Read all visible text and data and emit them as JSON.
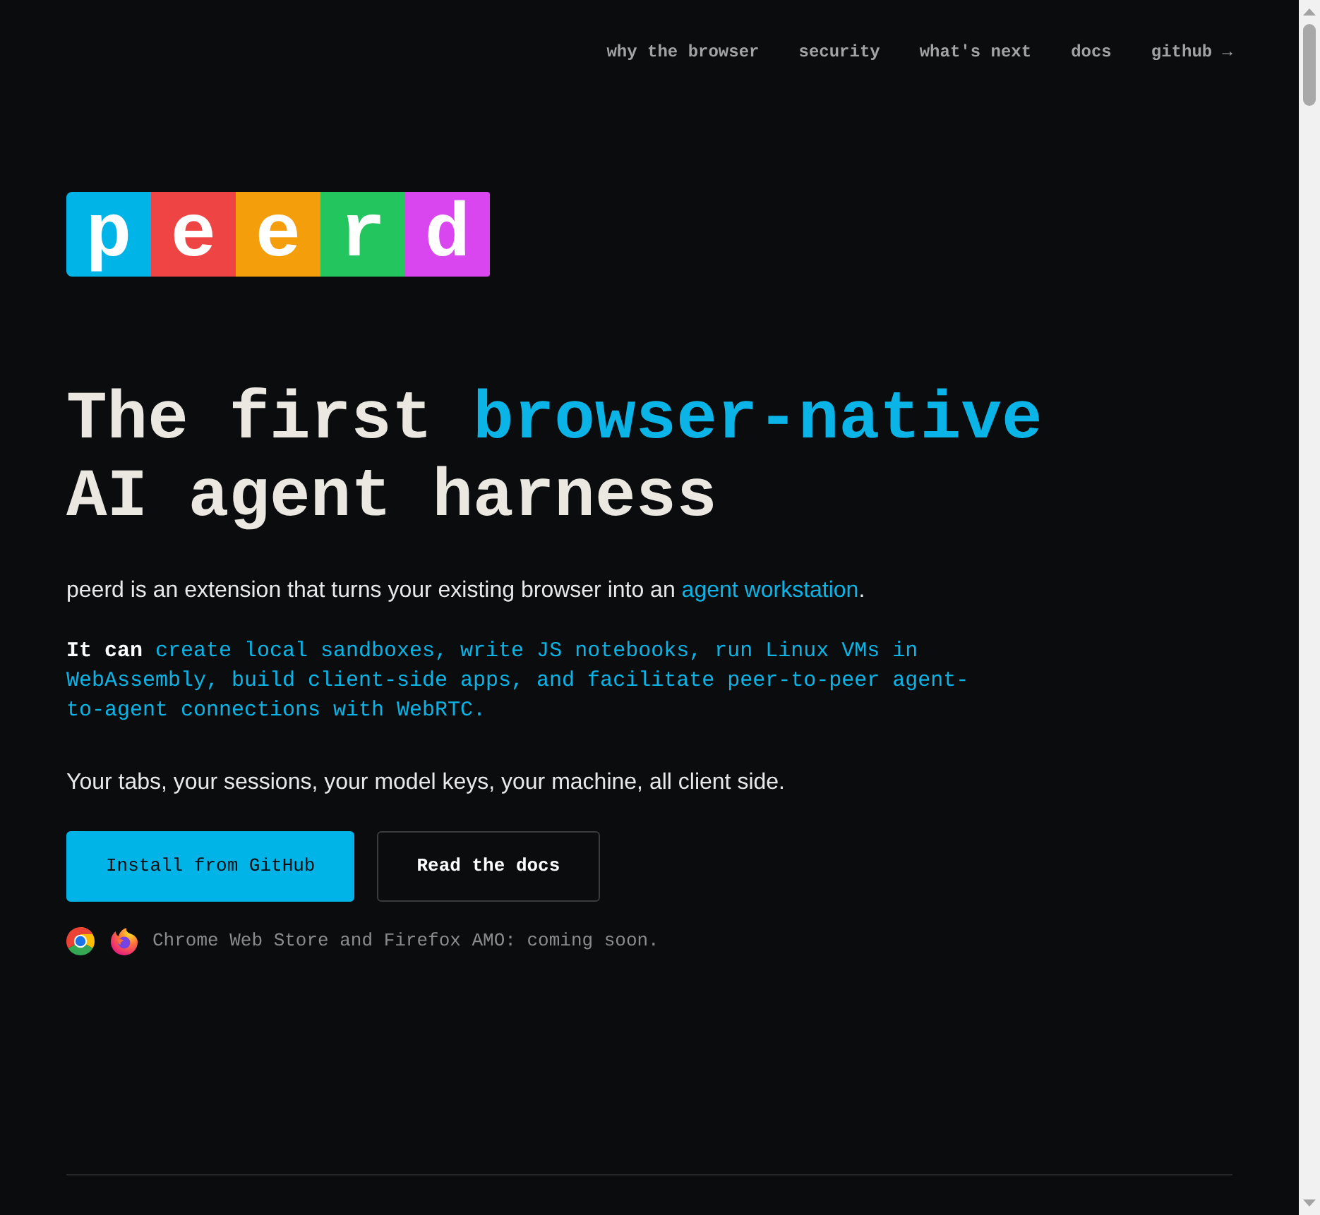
{
  "nav": {
    "links": [
      {
        "label": "why the browser"
      },
      {
        "label": "security"
      },
      {
        "label": "what's next"
      },
      {
        "label": "docs"
      },
      {
        "label": "github →"
      }
    ]
  },
  "logo": {
    "letters": [
      {
        "letter": "p",
        "color": "#00b4e8"
      },
      {
        "letter": "e",
        "color": "#ef4444"
      },
      {
        "letter": "e",
        "color": "#f59e0b"
      },
      {
        "letter": "r",
        "color": "#22c55e"
      },
      {
        "letter": "d",
        "color": "#d946ef"
      }
    ]
  },
  "hero": {
    "heading": [
      {
        "text": "The first ",
        "highlight": false
      },
      {
        "text": "browser-native",
        "highlight": true
      },
      {
        "text": " AI agent harness",
        "highlight": false
      }
    ],
    "intro": {
      "text": "peerd is an extension that turns your existing browser into an ",
      "link": "agent workstation",
      "end": "."
    },
    "capabilities": "**It can** create local sandboxes, write JS notebooks, run Linux VMs in WebAssembly, build client-side apps, and facilitate peer-to-peer agent-to-agent connections with WebRTC.",
    "tagline": "Your tabs, your sessions, your model keys, your machine, all client side.",
    "buttons": [
      {
        "label": "Install from GitHub",
        "kind": "primary"
      },
      {
        "label": "Read the docs",
        "kind": "secondary"
      }
    ],
    "availability": "Chrome Web Store and Firefox AMO: coming soon."
  }
}
